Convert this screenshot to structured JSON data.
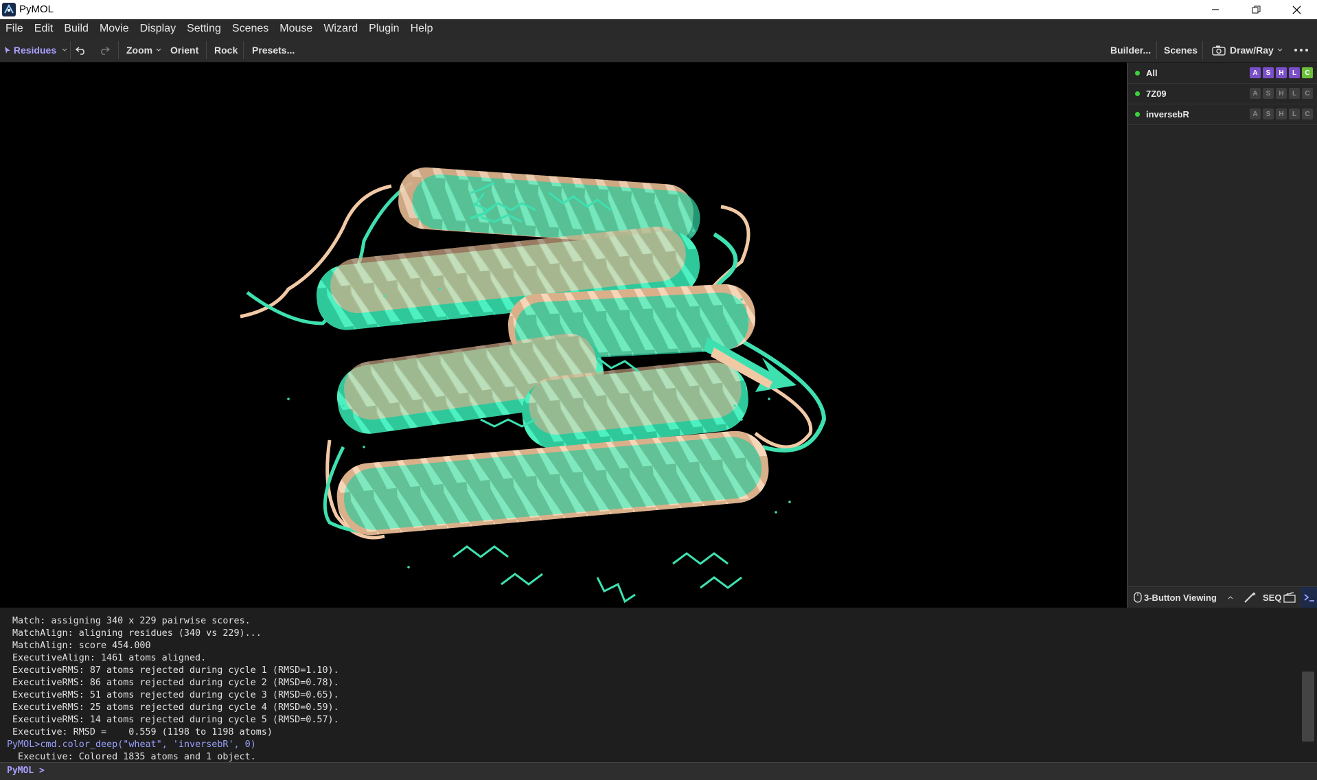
{
  "window": {
    "title": "PyMOL"
  },
  "menu": [
    "File",
    "Edit",
    "Build",
    "Movie",
    "Display",
    "Setting",
    "Scenes",
    "Mouse",
    "Wizard",
    "Plugin",
    "Help"
  ],
  "toolbar": {
    "selection_mode": "Residues",
    "zoom": "Zoom",
    "orient": "Orient",
    "rock": "Rock",
    "presets": "Presets...",
    "builder": "Builder...",
    "scenes": "Scenes",
    "draw_ray": "Draw/Ray"
  },
  "objects": [
    {
      "name": "All",
      "highlight": true
    },
    {
      "name": "7Z09",
      "highlight": false
    },
    {
      "name": "inversebR",
      "highlight": false
    }
  ],
  "ashlc": [
    "A",
    "S",
    "H",
    "L",
    "C"
  ],
  "ashlc_colors": {
    "A": "#7b4fc9",
    "S": "#7b4fc9",
    "H": "#7b4fc9",
    "L": "#7b4fc9",
    "C": "#6bbf3a"
  },
  "panel_footer": {
    "mouse_mode": "3-Button Viewing",
    "seq": "SEQ"
  },
  "console": {
    "lines": [
      "Match: assigning 340 x 229 pairwise scores.",
      "MatchAlign: aligning residues (340 vs 229)...",
      "MatchAlign: score 454.000",
      "ExecutiveAlign: 1461 atoms aligned.",
      "ExecutiveRMS: 87 atoms rejected during cycle 1 (RMSD=1.10).",
      "ExecutiveRMS: 86 atoms rejected during cycle 2 (RMSD=0.78).",
      "ExecutiveRMS: 51 atoms rejected during cycle 3 (RMSD=0.65).",
      "ExecutiveRMS: 25 atoms rejected during cycle 4 (RMSD=0.59).",
      "ExecutiveRMS: 14 atoms rejected during cycle 5 (RMSD=0.57).",
      "Executive: RMSD =    0.559 (1198 to 1198 atoms)"
    ],
    "command": "PyMOL>cmd.color_deep(\"wheat\", 'inversebR', 0)",
    "partial_line": " Executive: Colored 1835 atoms and 1 object."
  },
  "prompt": {
    "label": "PyMOL >",
    "value": ""
  },
  "colors": {
    "cartoon_a": "#3ee0b0",
    "cartoon_b": "#f2c9a5",
    "accent": "#9aa0ff"
  }
}
